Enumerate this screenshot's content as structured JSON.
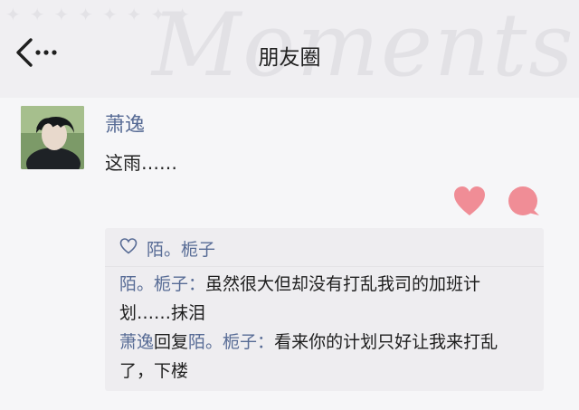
{
  "header": {
    "title": "朋友圈",
    "watermark": "Moments"
  },
  "post": {
    "author": "萧逸",
    "text": "这雨……"
  },
  "likes": {
    "names": "陌。栀子"
  },
  "comments": [
    {
      "author": "陌。栀子",
      "separator": "：",
      "text": "虽然很大但却没有打乱我司的加班计划……抹泪"
    },
    {
      "author": "萧逸",
      "reply_word": "回复",
      "reply_to": "陌。栀子",
      "separator": "：",
      "text": "看来你的计划只好让我来打乱了，下楼"
    }
  ],
  "colors": {
    "link": "#576b95",
    "heart": "#f08d96",
    "panel": "#eeedf0"
  },
  "icons": {
    "back": "back-arrow-icon",
    "like": "heart-icon",
    "comment": "comment-bubble-icon",
    "likes_prefix": "heart-outline-icon"
  }
}
